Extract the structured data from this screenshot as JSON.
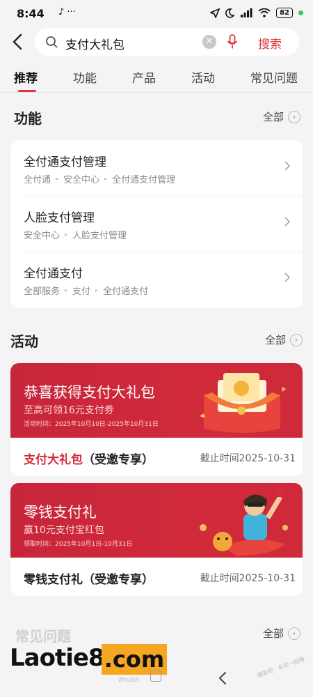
{
  "status_bar": {
    "time": "8:44",
    "left_icons": "♪ ···",
    "battery": "82"
  },
  "search": {
    "query": "支付大礼包",
    "button_label": "搜索"
  },
  "tabs": [
    {
      "label": "推荐",
      "active": true
    },
    {
      "label": "功能",
      "active": false
    },
    {
      "label": "产品",
      "active": false
    },
    {
      "label": "活动",
      "active": false
    },
    {
      "label": "常见问题",
      "active": false
    }
  ],
  "functions": {
    "title": "功能",
    "all_label": "全部",
    "items": [
      {
        "title": "全付通支付管理",
        "path": [
          "全付通",
          "安全中心",
          "全付通支付管理"
        ]
      },
      {
        "title": "人脸支付管理",
        "path": [
          "安全中心",
          "人脸支付管理"
        ]
      },
      {
        "title": "全付通支付",
        "path": [
          "全部服务",
          "支付",
          "全付通支付"
        ]
      }
    ]
  },
  "activities": {
    "title": "活动",
    "all_label": "全部",
    "items": [
      {
        "banner_title": "恭喜获得支付大礼包",
        "banner_subtitle": "至高可领16元支付券",
        "banner_date": "活动时间：2025年10月10日-2025年10月31日",
        "name_highlight": "支付大礼包",
        "name_rest": "（受邀专享）",
        "deadline": "截止时间2025-10-31"
      },
      {
        "banner_title": "零钱支付礼",
        "banner_subtitle": "赢10元支付宝红包",
        "banner_date": "领取时间：2025年10月1日-10月31日",
        "name_highlight": "",
        "name_rest": "零钱支付礼（受邀专享）",
        "deadline": "截止时间2025-10-31"
      }
    ]
  },
  "faq": {
    "title": "常见问题",
    "all_label": "全部"
  },
  "watermark": {
    "brand": "Laotie8",
    "domain": ".com",
    "small": "zhuan",
    "corner": "赚客吧 · 有奖一起赚"
  },
  "colors": {
    "accent": "#e0363a",
    "banner_red": "#c7253a",
    "watermark_orange": "#f5a623"
  }
}
